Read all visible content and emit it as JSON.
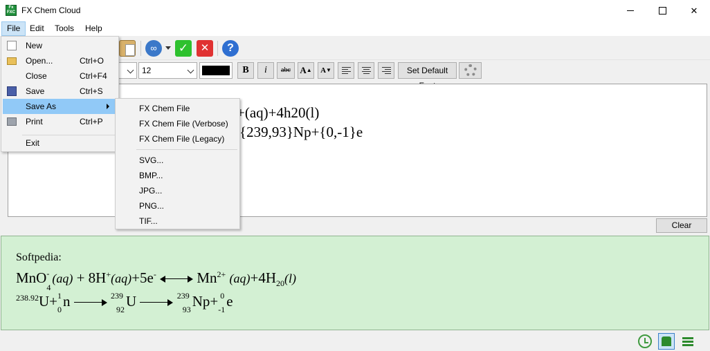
{
  "window": {
    "title": "FX Chem Cloud",
    "icon_text": "Fx FXC"
  },
  "menubar": [
    "File",
    "Edit",
    "Tools",
    "Help"
  ],
  "file_menu": [
    {
      "label": "New",
      "shortcut": ""
    },
    {
      "label": "Open...",
      "shortcut": "Ctrl+O"
    },
    {
      "label": "Close",
      "shortcut": "Ctrl+F4"
    },
    {
      "label": "Save",
      "shortcut": "Ctrl+S"
    },
    {
      "label": "Save As",
      "shortcut": ""
    },
    {
      "label": "Print",
      "shortcut": "Ctrl+P"
    },
    {
      "label": "Exit",
      "shortcut": ""
    }
  ],
  "save_as_menu": [
    "FX Chem File",
    "FX Chem File (Verbose)",
    "FX Chem File (Legacy)",
    "SVG...",
    "BMP...",
    "JPG...",
    "PNG...",
    "TIF..."
  ],
  "format_toolbar": {
    "font_size": "12",
    "text_color": "#000000",
    "bold": "B",
    "italic": "i",
    "strike": "abc",
    "grow": "A",
    "shrink": "A",
    "set_default_font": "Set Default Font"
  },
  "editor": {
    "line1_visible": "+(aq)+4h20(l)",
    "line2_visible": "{239,93}Np+{0,-1}e"
  },
  "clear_button": "Clear",
  "preview": {
    "heading": "Softpedia:",
    "line1": {
      "a": "MnO",
      "a_sub": "4",
      "a_sup": "-",
      "aq1": "(aq)",
      "plus1": " + 8H",
      "h_sup": "+",
      "aq2": "(aq)",
      "e1": "+5e",
      "e_sup": "-",
      "mn": "Mn",
      "mn_sup": "2+",
      "aq3": "(aq)",
      "h2o": "+4H",
      "h2o_sub": "20",
      "liq": "(l)"
    },
    "line2": {
      "u_sup": "238.92",
      "u": "U+",
      "n_sup": "1",
      "n_sub": "0",
      "n": "n",
      "u2_sup": "239",
      "u2_sub": "92",
      "u2": "U",
      "np_sup": "239",
      "np_sub": "93",
      "np": "Np+",
      "e_sup": "0",
      "e_sub": "-1",
      "e": "e"
    }
  },
  "colors": {
    "preview_bg": "#d3f0d3",
    "menu_highlight": "#91c9f7",
    "accent_green": "#2d8a2d"
  }
}
